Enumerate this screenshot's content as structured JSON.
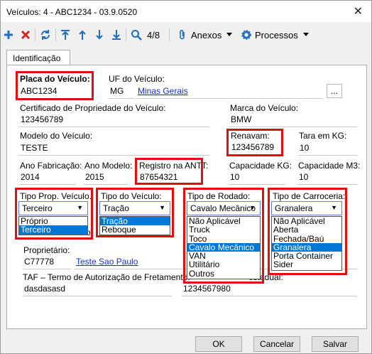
{
  "window": {
    "title": "Veículos: 4 - ABC1234 - 03.9.0520",
    "close_glyph": "✕"
  },
  "toolbar": {
    "record_position": "4/8",
    "anexos_label": "Anexos",
    "processos_label": "Processos",
    "accent_blue": "#1f6fc5",
    "accent_red": "#d9261c"
  },
  "tabs": [
    {
      "label": "Identificação"
    }
  ],
  "form": {
    "placa": {
      "label": "Placa do Veículo:",
      "value": "ABC1234"
    },
    "uf": {
      "label": "UF do Veículo:",
      "code": "MG",
      "name": "Minas Gerais",
      "button": "..."
    },
    "certificado": {
      "label": "Certificado de Propriedade do Veículo:",
      "value": "123456789"
    },
    "marca": {
      "label": "Marca do Veículo:",
      "value": "BMW"
    },
    "modelo": {
      "label": "Modelo do Veículo:",
      "value": "TESTE"
    },
    "renavam": {
      "label": "Renavam:",
      "value": "123456789"
    },
    "tara": {
      "label": "Tara em KG:",
      "value": "10"
    },
    "ano_fabricacao": {
      "label": "Ano Fabricação:",
      "value": "2014"
    },
    "ano_modelo": {
      "label": "Ano Modelo:",
      "value": "2015"
    },
    "antt": {
      "label": "Registro na ANTT:",
      "value": "87654321"
    },
    "capacidade_kg": {
      "label": "Capacidade KG:",
      "value": "10"
    },
    "capacidade_m3": {
      "label": "Capacidade M3:",
      "value": "10"
    },
    "tipo_prop": {
      "label": "Tipo Prop. Veículo.:",
      "value": "Terceiro",
      "options": [
        "Próprio",
        "Terceiro"
      ],
      "selected_index": 1
    },
    "tipo_veiculo": {
      "label": "Tipo do Veículo:",
      "value": "Tração",
      "options": [
        "Tração",
        "Reboque"
      ],
      "selected_index": 0
    },
    "tipo_rodado": {
      "label": "Tipo de Rodado:",
      "value": "Cavalo Mecânico",
      "options": [
        "Não Aplicável",
        "Truck",
        "Toco",
        "Cavalo Mecânico",
        "VAN",
        "Utilitário",
        "Outros"
      ],
      "selected_index": 3
    },
    "tipo_carroceria": {
      "label": "Tipo de Carroceria:",
      "value": "Granalera",
      "options": [
        "Não Aplicável",
        "Aberta",
        "Fechada/Baú",
        "Granalera",
        "Porta Container",
        "Sider"
      ],
      "selected_index": 3
    },
    "proprietario": {
      "label": "Proprietário:",
      "code": "C77778",
      "name": "Teste Sao Paulo"
    },
    "taf": {
      "label": "TAF – Termo de Autorização de Fretamento:",
      "value": "dasdasasd"
    },
    "estadual": {
      "label_fragment": "estadual:",
      "value": "1234567980"
    },
    "hidden_fragment": "o"
  },
  "buttons": {
    "ok": "OK",
    "cancel": "Cancelar",
    "save": "Salvar"
  }
}
